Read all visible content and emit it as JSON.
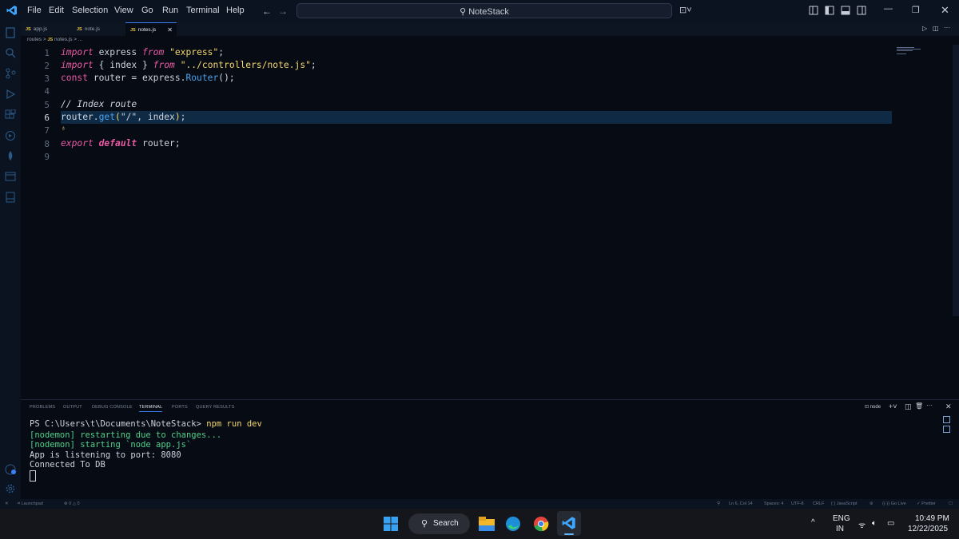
{
  "menubar": {
    "items": [
      "File",
      "Edit",
      "Selection",
      "View",
      "Go",
      "Run",
      "Terminal",
      "Help"
    ],
    "search_label": "NoteStack"
  },
  "tabs": [
    {
      "icon": "JS",
      "label": "app.js",
      "active": false
    },
    {
      "icon": "JS",
      "label": "note.js",
      "active": false
    },
    {
      "icon": "JS",
      "label": "notes.js",
      "active": true
    }
  ],
  "breadcrumb": {
    "folder": "routes",
    "sep": ">",
    "icon": "JS",
    "file": "notes.js",
    "tail": "> ..."
  },
  "editor": {
    "current_line": 6,
    "line_numbers": [
      "1",
      "2",
      "3",
      "4",
      "5",
      "6",
      "7",
      "8",
      "9"
    ]
  },
  "panel": {
    "tabs": [
      "PROBLEMS",
      "OUTPUT",
      "DEBUG CONSOLE",
      "TERMINAL",
      "PORTS",
      "QUERY RESULTS"
    ],
    "active_tab": "TERMINAL",
    "shell_label": "node",
    "terminal": {
      "prompt": "PS C:\\Users\\t\\Documents\\NoteStack> ",
      "command": "npm run dev",
      "line2": "[nodemon] restarting due to changes...",
      "line3": "[nodemon] starting `node app.js`",
      "line4": "App is listening to port: 8080",
      "line5": "Connected To DB"
    }
  },
  "statusbar": {
    "left_item": "Launchpad",
    "problems": "0",
    "warnings": "0",
    "position": "Ln 6, Col 14",
    "spaces": "Spaces: 4",
    "encoding": "UTF-8",
    "eol": "CRLF",
    "language": "JavaScript",
    "golive": "Go Live",
    "prettier": "Prettier"
  },
  "taskbar": {
    "search_label": "Search",
    "lang_top": "ENG",
    "lang_bottom": "IN",
    "time": "10:49 PM",
    "date": "12/22/2025"
  },
  "colors": {
    "accent": "#3b82f6",
    "keyword": "#ea5aa6",
    "string": "#f5d76e",
    "function": "#4aa3f0",
    "terminal_green": "#4fd18b"
  }
}
